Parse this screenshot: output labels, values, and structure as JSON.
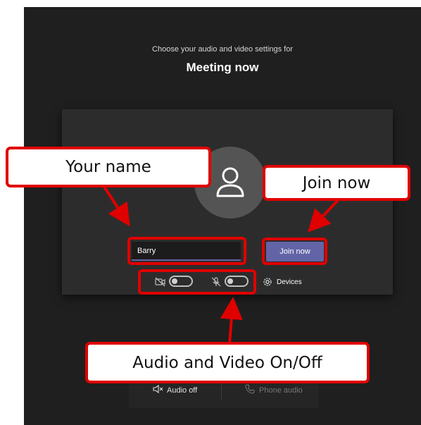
{
  "prejoin": {
    "subtitle": "Choose your audio and video settings for",
    "meeting_title": "Meeting now",
    "name_value": "Barry",
    "join_label": "Join now",
    "devices_label": "Devices"
  },
  "audio_bar": {
    "audio_off_label": "Audio off",
    "phone_audio_label": "Phone audio"
  },
  "annotations": {
    "your_name": "Your name",
    "join_now": "Join now",
    "audio_video": "Audio and Video On/Off"
  },
  "colors": {
    "background": "#1f1f1f",
    "card": "#2d2c2c",
    "accent": "#6264a7",
    "annotation_red": "#e00000"
  },
  "icons": [
    "person-icon",
    "video-off-icon",
    "mic-off-icon",
    "gear-icon",
    "speaker-off-icon",
    "phone-icon"
  ]
}
